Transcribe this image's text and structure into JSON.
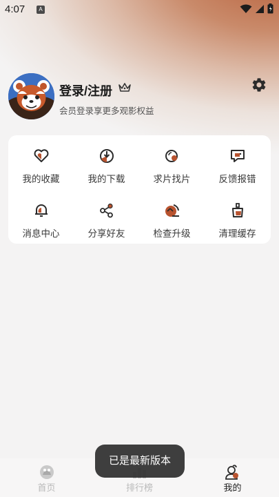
{
  "status": {
    "time": "4:07",
    "notification_badge": "A"
  },
  "profile": {
    "login_label": "登录/注册",
    "member_benefit": "会员登录享更多观影权益",
    "avatar_icon": "red-panda-avatar",
    "vip_icon": "crown-icon"
  },
  "settings_icon": "gear-icon",
  "menu": {
    "items": [
      {
        "label": "我的收藏",
        "icon": "heart-icon"
      },
      {
        "label": "我的下载",
        "icon": "download-icon"
      },
      {
        "label": "求片找片",
        "icon": "search-film-icon"
      },
      {
        "label": "反馈报错",
        "icon": "feedback-icon"
      },
      {
        "label": "消息中心",
        "icon": "bell-icon"
      },
      {
        "label": "分享好友",
        "icon": "share-icon"
      },
      {
        "label": "检查升级",
        "icon": "upgrade-icon"
      },
      {
        "label": "清理缓存",
        "icon": "clean-cache-icon"
      }
    ]
  },
  "bottom_nav": {
    "items": [
      {
        "label": "首页",
        "icon": "home-icon",
        "active": false
      },
      {
        "label": "排行榜",
        "icon": "ranking-icon",
        "active": false
      },
      {
        "label": "我的",
        "icon": "profile-icon",
        "active": true
      }
    ]
  },
  "toast": {
    "message": "已是最新版本"
  },
  "colors": {
    "accent": "#b8532f",
    "brand_dark": "#2b2b2b",
    "card_bg": "#ffffff"
  }
}
